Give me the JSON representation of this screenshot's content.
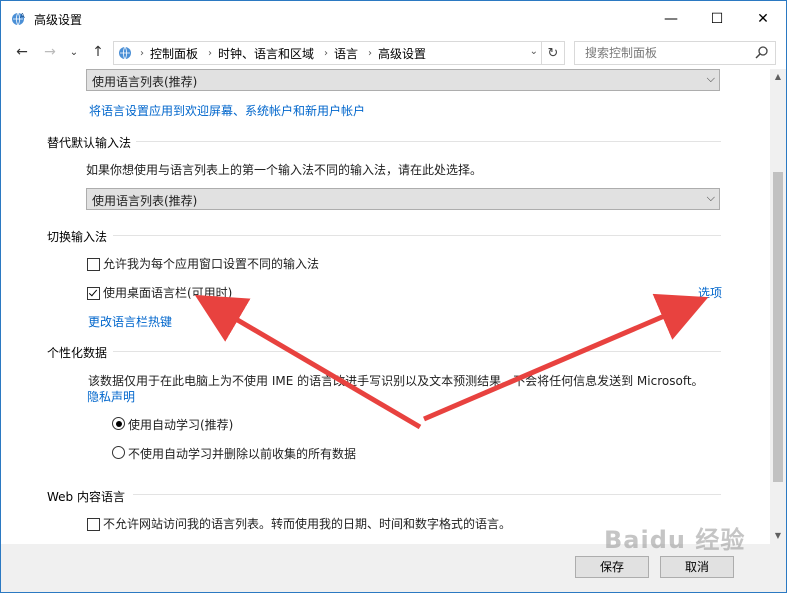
{
  "window": {
    "title": "高级设置"
  },
  "titlebar_buttons": {
    "minimize": "—",
    "maximize": "☐",
    "close": "✕"
  },
  "nav": {
    "back": "←",
    "forward": "→",
    "recent": "⌄",
    "up": "↑",
    "breadcrumb": [
      "控制面板",
      "时钟、语言和区域",
      "语言",
      "高级设置"
    ],
    "refresh": "↻",
    "search_placeholder": "搜索控制面板"
  },
  "top_select": {
    "value": "使用语言列表(推荐)"
  },
  "apply_link": "将语言设置应用到欢迎屏幕、系统帐户和新用户帐户",
  "override_input": {
    "heading": "替代默认输入法",
    "description": "如果你想使用与语言列表上的第一个输入法不同的输入法，请在此处选择。",
    "select_value": "使用语言列表(推荐)"
  },
  "switch_input": {
    "heading": "切换输入法",
    "option1": {
      "label": "允许我为每个应用窗口设置不同的输入法",
      "checked": false
    },
    "option2": {
      "label": "使用桌面语言栏(可用时)",
      "checked": true
    },
    "options_link": "选项",
    "hotkey_link": "更改语言栏热键"
  },
  "personalization": {
    "heading": "个性化数据",
    "description": "该数据仅用于在此电脑上为不使用 IME 的语言改进手写识别以及文本预测结果。不会将任何信息发送到 Microsoft。",
    "privacy_link": "隐私声明",
    "radio1": {
      "label": "使用自动学习(推荐)",
      "checked": true
    },
    "radio2": {
      "label": "不使用自动学习并删除以前收集的所有数据",
      "checked": false
    }
  },
  "web_content": {
    "heading": "Web 内容语言",
    "option": {
      "label": "不允许网站访问我的语言列表。转而使用我的日期、时间和数字格式的语言。",
      "checked": false
    }
  },
  "footer": {
    "save": "保存",
    "cancel": "取消"
  },
  "watermark": "Baidu 经验",
  "colors": {
    "link": "#0066cc",
    "arrow": "#e8423f",
    "border": "#2b79c2"
  }
}
